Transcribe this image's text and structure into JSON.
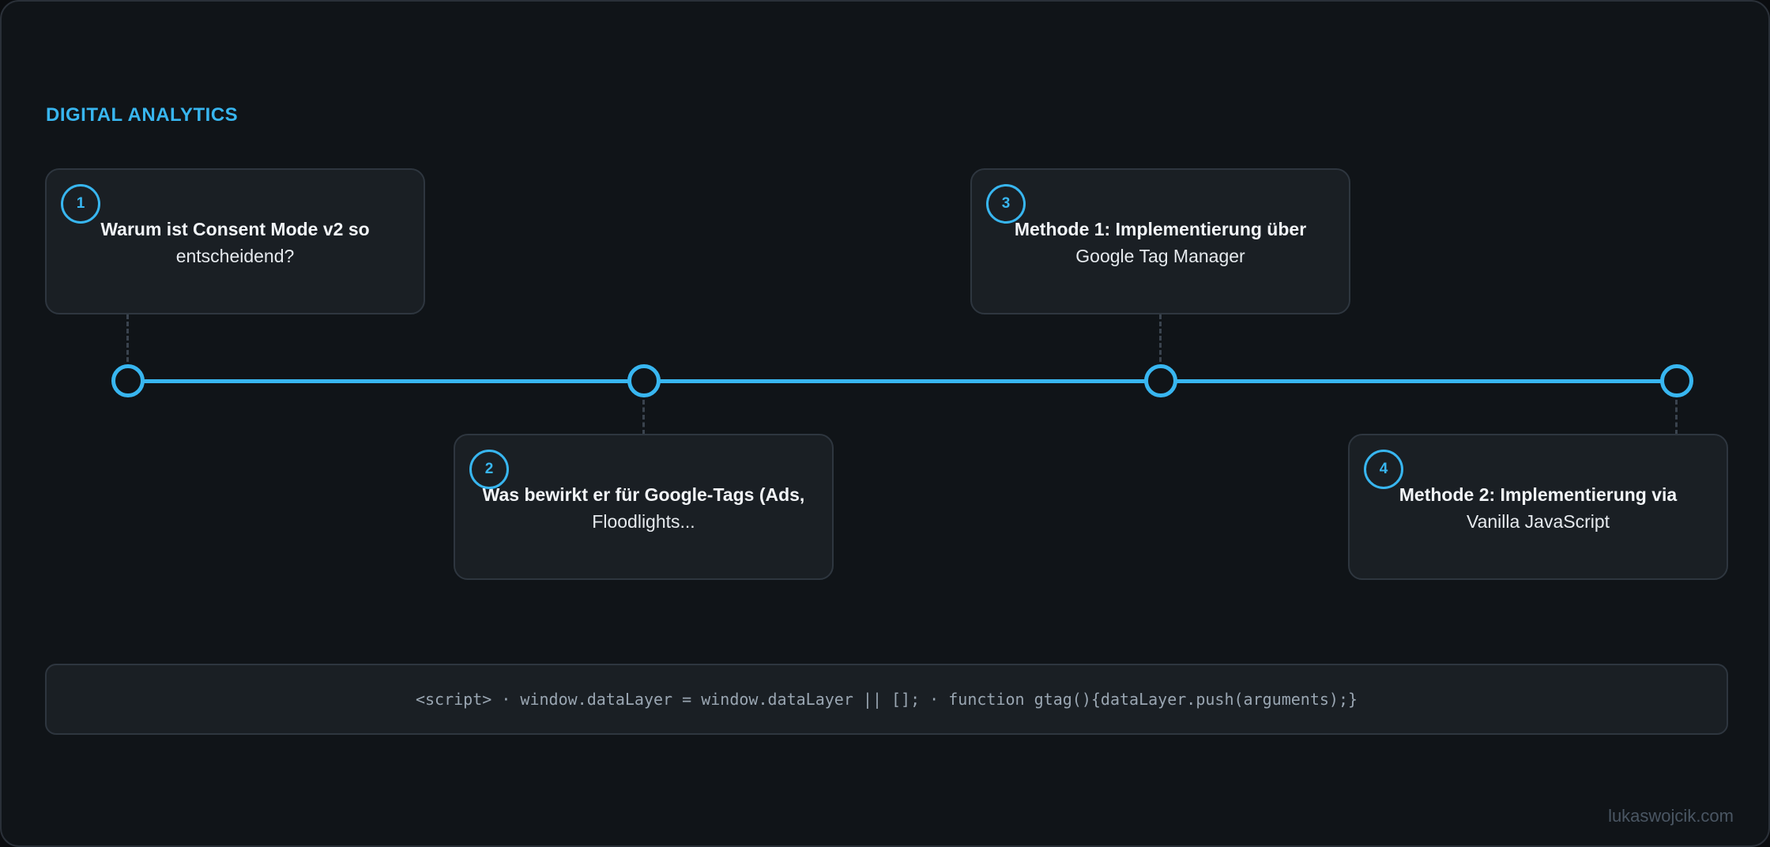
{
  "header": {
    "eyebrow": "DIGITAL ANALYTICS"
  },
  "timeline": {
    "accent_color": "#38b6f0",
    "steps": [
      {
        "number": "1",
        "title": "Warum ist Consent Mode v2 so",
        "subtitle": "entscheidend?",
        "position": "above"
      },
      {
        "number": "2",
        "title": "Was bewirkt er für Google-Tags (Ads,",
        "subtitle": "Floodlights...",
        "position": "below"
      },
      {
        "number": "3",
        "title": "Methode 1: Implementierung über",
        "subtitle": "Google Tag Manager",
        "position": "above"
      },
      {
        "number": "4",
        "title": "Methode 2: Implementierung via",
        "subtitle": "Vanilla JavaScript",
        "position": "below"
      }
    ]
  },
  "code_snippet": "<script> · window.dataLayer = window.dataLayer || []; · function gtag(){dataLayer.push(arguments);}",
  "footer": {
    "site": "lukaswojcik.com"
  }
}
